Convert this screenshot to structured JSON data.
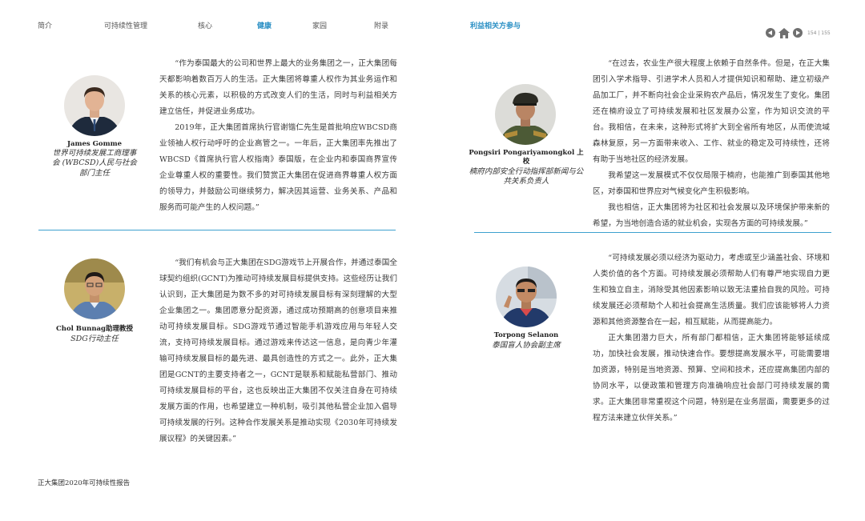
{
  "nav": {
    "items": [
      {
        "label": "简介",
        "active": false
      },
      {
        "label": "可持续性管理",
        "active": false
      },
      {
        "label": "核心",
        "active": false
      },
      {
        "label": "健康",
        "active": true
      },
      {
        "label": "家园",
        "active": false
      },
      {
        "label": "附录",
        "active": false
      }
    ],
    "section_title": "利益相关方参与",
    "page_numbers": "154 | 155"
  },
  "testimonials": [
    {
      "name": "James Gomme",
      "role": "世界可持续发展工商理事会 (WBCSD)人民与社会部门主任",
      "paragraphs": [
        "“作为泰国最大的公司和世界上最大的业务集团之一，正大集团每天都影响着数百万人的生活。正大集团将尊重人权作为其业务运作和关系的核心元素，以积极的方式改变人们的生活，同时与利益相关方建立信任，并促进业务成功。",
        "2019年，正大集团首席执行官谢锴仁先生是首批响应WBCSD商业领袖人权行动呼吁的企业高管之一。一年后，正大集团率先推出了WBCSD《首席执行官人权指南》泰国版，在企业内和泰国商界宣传企业尊重人权的重要性。我们赞赏正大集团在促进商界尊重人权方面的领导力，并鼓励公司继续努力，解决因其运营、业务关系、产品和服务而可能产生的人权问题。”"
      ]
    },
    {
      "name": "Pongsiri Pongariyamongkol 上校",
      "role": "楠府内部安全行动指挥部新闻与公共关系负责人",
      "paragraphs": [
        "“在过去，农业生产很大程度上依赖于自然条件。但是，在正大集团引入学术指导、引进学术人员和人才提供知识和帮助、建立初级产品加工厂，并不断向社会企业采购农产品后，情况发生了变化。集团还在楠府设立了可持续发展和社区发展办公室，作为知识交流的平台。我相信，在未来，这种形式将扩大到全省所有地区，从而使流域森林复原，另一方面带来收入、工作、就业的稳定及可持续性，还将有助于当地社区的经济发展。",
        "我希望这一发展模式不仅仅局限于楠府，也能推广到泰国其他地区，对泰国和世界应对气候变化产生积极影响。",
        "我也相信，正大集团将为社区和社会发展以及环境保护带来新的希望，为当地创造合适的就业机会，实现各方面的可持续发展。”"
      ]
    },
    {
      "name": "Chol Bunnag助理教授",
      "role": "SDG行动主任",
      "paragraphs": [
        "“我们有机会与正大集团在SDG游戏节上开展合作，并通过泰国全球契约组织(GCNT)为推动可持续发展目标提供支持。这些经历让我们认识到，正大集团是为数不多的对可持续发展目标有深刻理解的大型企业集团之一。集团愿意分配资源，通过成功预期高的创意项目来推动可持续发展目标。SDG游戏节通过智能手机游戏应用与年轻人交流，支持可持续发展目标。通过游戏来传达这一信息，是向青少年灌输可持续发展目标的最先进、最具创造性的方式之一。此外，正大集团是GCNT的主要支持者之一，GCNT是联系和赋能私营部门、推动可持续发展目标的平台，这也反映出正大集团不仅关注自身在可持续发展方面的作用，也希望建立一种机制，吸引其他私营企业加入倡导可持续发展的行列。这种合作发展关系是推动实现《2030年可持续发展议程》的关键因素。”"
      ]
    },
    {
      "name": "Torpong Selanon",
      "role": "泰国盲人协会副主席",
      "paragraphs": [
        "“可持续发展必须以经济为驱动力，考虑或至少涵盖社会、环境和人类价值的各个方面。可持续发展必须帮助人们有尊严地实现自力更生和独立自主，消除受其他因素影响以致无法重拾自我的风险。可持续发展还必须帮助个人和社会提高生活质量。我们应该能够将人力资源和其他资源整合在一起，相互赋能，从而提高能力。",
        "正大集团潜力巨大，所有部门都相信，正大集团将能够延续成功，加快社会发展，推动快速合作。要想提高发展水平，可能需要增加资源，特别是当地资源、预算、空间和技术，还应提高集团内部的协同水平，以便政策和管理方向准确响应社会部门可持续发展的需求。正大集团非常重视这个问题，特别是在业务层面，需要更多的过程方法来建立伙伴关系。”"
      ]
    }
  ],
  "footer": "正大集团2020年可持续性报告",
  "colors": {
    "accent": "#2a8fc4",
    "divider": "#3ea1cf",
    "text": "#3a3a3a"
  }
}
